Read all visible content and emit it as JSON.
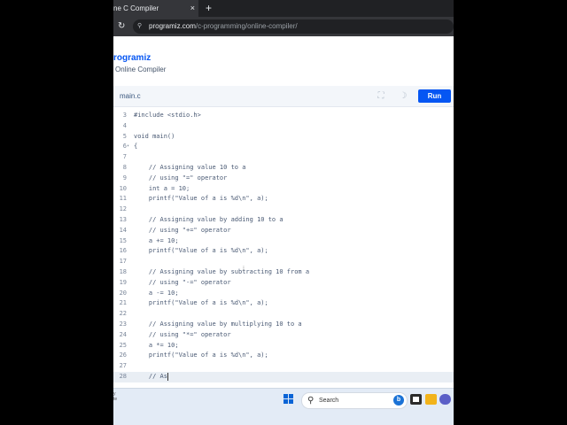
{
  "browser": {
    "tab_title": "ne C Compiler",
    "tab_close": "×",
    "new_tab": "+",
    "url_host": "programiz.com",
    "url_path": "/c-programming/online-compiler/"
  },
  "site": {
    "logo": "rogramiz",
    "subtitle": "Online Compiler"
  },
  "toolbar": {
    "file_tab": "main.c",
    "run_label": "Run"
  },
  "editor": {
    "lines": [
      {
        "n": "3",
        "fold": "",
        "code": "#include <stdio.h>"
      },
      {
        "n": "4",
        "fold": "",
        "code": ""
      },
      {
        "n": "5",
        "fold": "",
        "code": "void main()"
      },
      {
        "n": "6",
        "fold": "▾",
        "code": "{"
      },
      {
        "n": "7",
        "fold": "",
        "code": ""
      },
      {
        "n": "8",
        "fold": "",
        "code": "    // Assigning value 10 to a"
      },
      {
        "n": "9",
        "fold": "",
        "code": "    // using \"=\" operator"
      },
      {
        "n": "10",
        "fold": "",
        "code": "    int a = 10;"
      },
      {
        "n": "11",
        "fold": "",
        "code": "    printf(\"Value of a is %d\\n\", a);"
      },
      {
        "n": "12",
        "fold": "",
        "code": ""
      },
      {
        "n": "13",
        "fold": "",
        "code": "    // Assigning value by adding 10 to a"
      },
      {
        "n": "14",
        "fold": "",
        "code": "    // using \"+=\" operator"
      },
      {
        "n": "15",
        "fold": "",
        "code": "    a += 10;"
      },
      {
        "n": "16",
        "fold": "",
        "code": "    printf(\"Value of a is %d\\n\", a);"
      },
      {
        "n": "17",
        "fold": "",
        "code": ""
      },
      {
        "n": "18",
        "fold": "",
        "code": "    // Assigning value by subtracting 10 from a"
      },
      {
        "n": "19",
        "fold": "",
        "code": "    // using \"-=\" operator"
      },
      {
        "n": "20",
        "fold": "",
        "code": "    a -= 10;"
      },
      {
        "n": "21",
        "fold": "",
        "code": "    printf(\"Value of a is %d\\n\", a);"
      },
      {
        "n": "22",
        "fold": "",
        "code": ""
      },
      {
        "n": "23",
        "fold": "",
        "code": "    // Assigning value by multiplying 10 to a"
      },
      {
        "n": "24",
        "fold": "",
        "code": "    // using \"*=\" operator"
      },
      {
        "n": "25",
        "fold": "",
        "code": "    a *= 10;"
      },
      {
        "n": "26",
        "fold": "",
        "code": "    printf(\"Value of a is %d\\n\", a);"
      },
      {
        "n": "27",
        "fold": "",
        "code": ""
      },
      {
        "n": "28",
        "fold": "",
        "code": "    // As",
        "active": true
      }
    ]
  },
  "taskbar": {
    "search_label": "Search",
    "left_text": "y\nte"
  },
  "icons": {
    "reload": "reload-icon",
    "lock": "lock-icon",
    "fullscreen": "fullscreen-icon",
    "theme": "moon-icon",
    "windows": "windows-start-icon",
    "search": "search-icon"
  },
  "colors": {
    "accent": "#0556f3",
    "gutter": "#7a8699",
    "code": "#4a5a74"
  }
}
